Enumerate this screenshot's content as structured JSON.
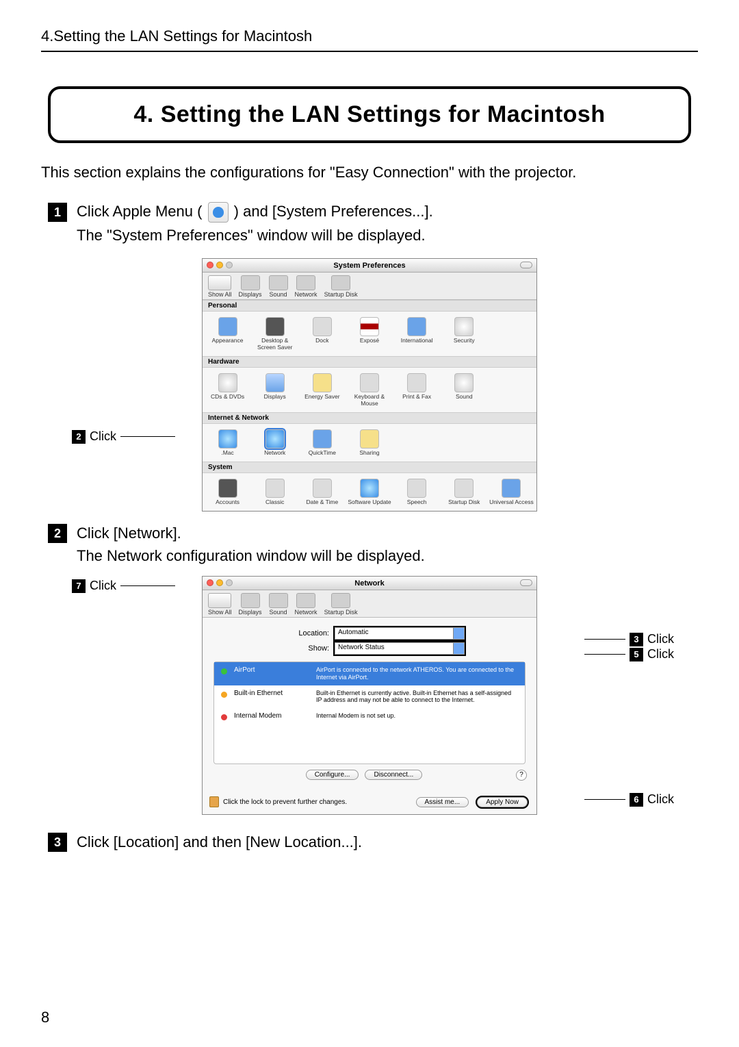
{
  "page": {
    "running_header": "4.Setting the LAN Settings for Macintosh",
    "title": "4. Setting the LAN Settings for Macintosh",
    "intro": "This section explains the configurations for \"Easy Connection\" with the projector.",
    "page_number": "8"
  },
  "steps": {
    "s1_pre": "Click Apple Menu (",
    "s1_post": ") and [System Preferences...].",
    "s1_sub": "The \"System Preferences\" window will be displayed.",
    "s2": "Click [Network].",
    "s2_sub": "The Network configuration window will be displayed.",
    "s3": "Click [Location] and then [New Location...]."
  },
  "callouts": {
    "click": "Click"
  },
  "sysprefs": {
    "title": "System Preferences",
    "toolbar": {
      "showall": "Show All",
      "displays": "Displays",
      "sound": "Sound",
      "network": "Network",
      "startup": "Startup Disk"
    },
    "sections": {
      "personal": "Personal",
      "hardware": "Hardware",
      "internet": "Internet & Network",
      "system": "System"
    },
    "personal": [
      "Appearance",
      "Desktop & Screen Saver",
      "Dock",
      "Exposé",
      "International",
      "Security"
    ],
    "hardware": [
      "CDs & DVDs",
      "Displays",
      "Energy Saver",
      "Keyboard & Mouse",
      "Print & Fax",
      "Sound"
    ],
    "internet": [
      ".Mac",
      "Network",
      "QuickTime",
      "Sharing"
    ],
    "system": [
      "Accounts",
      "Classic",
      "Date & Time",
      "Software Update",
      "Speech",
      "Startup Disk",
      "Universal Access"
    ]
  },
  "network": {
    "title": "Network",
    "toolbar": {
      "showall": "Show All",
      "displays": "Displays",
      "sound": "Sound",
      "network": "Network",
      "startup": "Startup Disk"
    },
    "location_label": "Location:",
    "location_value": "Automatic",
    "show_label": "Show:",
    "show_value": "Network Status",
    "status": [
      {
        "name": "AirPort",
        "desc": "AirPort is connected to the network ATHEROS. You are connected to the Internet via AirPort."
      },
      {
        "name": "Built-in Ethernet",
        "desc": "Built-in Ethernet is currently active. Built-in Ethernet has a self-assigned IP address and may not be able to connect to the Internet."
      },
      {
        "name": "Internal Modem",
        "desc": "Internal Modem is not set up."
      }
    ],
    "configure_btn": "Configure...",
    "disconnect_btn": "Disconnect...",
    "lock_text": "Click the lock to prevent further changes.",
    "assist_btn": "Assist me...",
    "apply_btn": "Apply Now"
  }
}
